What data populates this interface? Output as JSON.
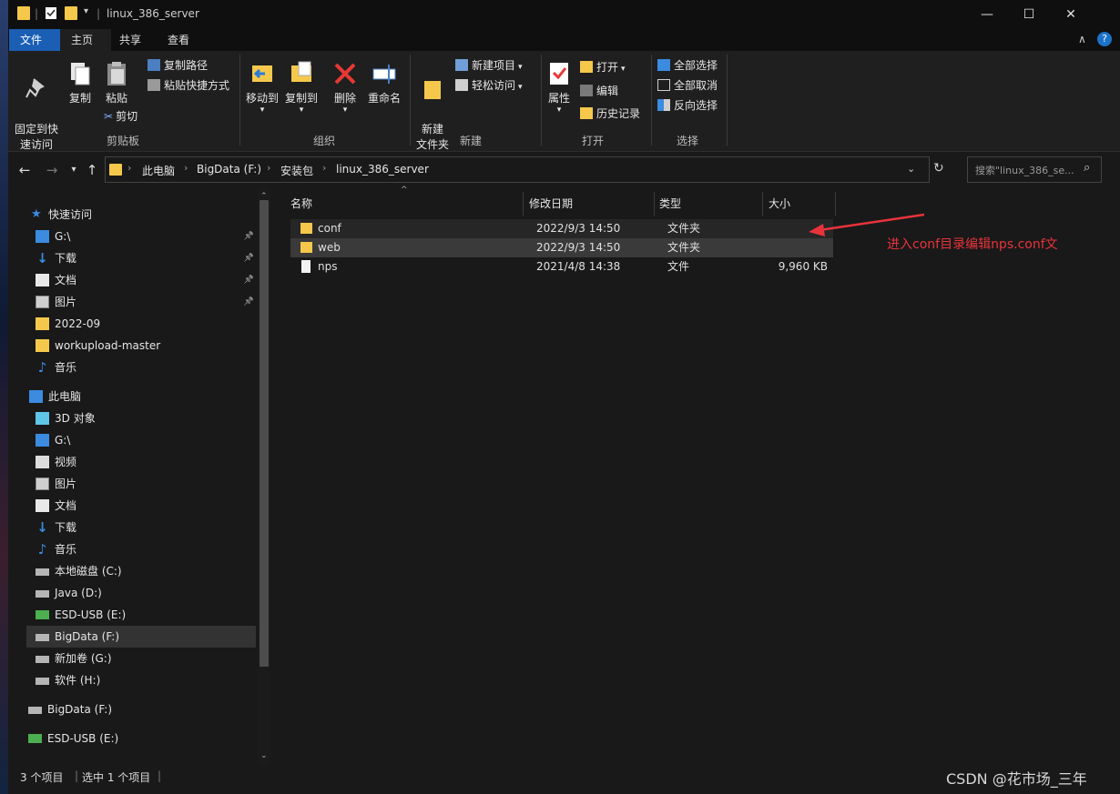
{
  "window": {
    "title": "linux_386_server"
  },
  "title_controls": {
    "minimize": "—",
    "maximize": "☐",
    "close": "✕"
  },
  "tabs": [
    {
      "label": "文件"
    },
    {
      "label": "主页"
    },
    {
      "label": "共享"
    },
    {
      "label": "查看"
    }
  ],
  "ribbon": {
    "clipboard": {
      "pin": "固定到快\n速访问",
      "copy": "复制",
      "paste": "粘贴",
      "copy_path": "复制路径",
      "paste_shortcut": "粘贴快捷方式",
      "cut": "剪切",
      "group_label": "剪贴板"
    },
    "organize": {
      "move_to": "移动到",
      "copy_to": "复制到",
      "delete": "删除",
      "rename": "重命名",
      "group_label": "组织"
    },
    "new": {
      "new_folder": "新建\n文件夹",
      "new_item": "新建项目",
      "easy_access": "轻松访问",
      "group_label": "新建"
    },
    "open": {
      "properties": "属性",
      "open": "打开",
      "edit": "编辑",
      "history": "历史记录",
      "group_label": "打开"
    },
    "select": {
      "select_all": "全部选择",
      "select_none": "全部取消",
      "invert": "反向选择",
      "group_label": "选择"
    }
  },
  "address": {
    "crumbs": [
      "此电脑",
      "BigData (F:)",
      "安装包",
      "linux_386_server"
    ],
    "search_placeholder": "搜索\"linux_386_se..."
  },
  "sidebar": {
    "quick_access": "快速访问",
    "quick_items": [
      {
        "label": "G:\\",
        "icon": "drive-icon",
        "pinned": true
      },
      {
        "label": "下载",
        "icon": "download-icon",
        "pinned": true
      },
      {
        "label": "文档",
        "icon": "document-icon",
        "pinned": true
      },
      {
        "label": "图片",
        "icon": "picture-icon",
        "pinned": true
      },
      {
        "label": "2022-09",
        "icon": "folder-icon",
        "pinned": false
      },
      {
        "label": "workupload-master",
        "icon": "folder-icon",
        "pinned": false
      },
      {
        "label": "音乐",
        "icon": "music-icon",
        "pinned": false
      }
    ],
    "this_pc": "此电脑",
    "pc_items": [
      {
        "label": "3D 对象",
        "icon": "cube-icon"
      },
      {
        "label": "G:\\",
        "icon": "drive-icon"
      },
      {
        "label": "视频",
        "icon": "video-icon"
      },
      {
        "label": "图片",
        "icon": "picture-icon"
      },
      {
        "label": "文档",
        "icon": "document-icon"
      },
      {
        "label": "下载",
        "icon": "download-icon"
      },
      {
        "label": "音乐",
        "icon": "music-icon"
      },
      {
        "label": "本地磁盘 (C:)",
        "icon": "disk-icon"
      },
      {
        "label": "Java (D:)",
        "icon": "disk-icon"
      },
      {
        "label": "ESD-USB (E:)",
        "icon": "usb-icon"
      },
      {
        "label": "BigData (F:)",
        "icon": "disk-icon",
        "selected": true
      },
      {
        "label": "新加卷 (G:)",
        "icon": "disk-icon"
      },
      {
        "label": "软件 (H:)",
        "icon": "disk-icon"
      }
    ],
    "extra_items": [
      {
        "label": "BigData (F:)",
        "icon": "disk-icon"
      },
      {
        "label": "ESD-USB (E:)",
        "icon": "usb-icon"
      }
    ]
  },
  "columns": {
    "name": "名称",
    "date": "修改日期",
    "type": "类型",
    "size": "大小"
  },
  "files": [
    {
      "name": "conf",
      "date": "2022/9/3 14:50",
      "type": "文件夹",
      "size": "",
      "kind": "folder"
    },
    {
      "name": "web",
      "date": "2022/9/3 14:50",
      "type": "文件夹",
      "size": "",
      "kind": "folder"
    },
    {
      "name": "nps",
      "date": "2021/4/8 14:38",
      "type": "文件",
      "size": "9,960 KB",
      "kind": "file"
    }
  ],
  "annotation": "进入conf目录编辑nps.conf文",
  "status": {
    "count": "3 个项目",
    "selected": "选中 1 个项目"
  },
  "watermark": "CSDN @花市场_三年",
  "colors": {
    "accent": "#1a5fb4",
    "folder": "#f5c84c",
    "annotation": "#e8333b"
  }
}
